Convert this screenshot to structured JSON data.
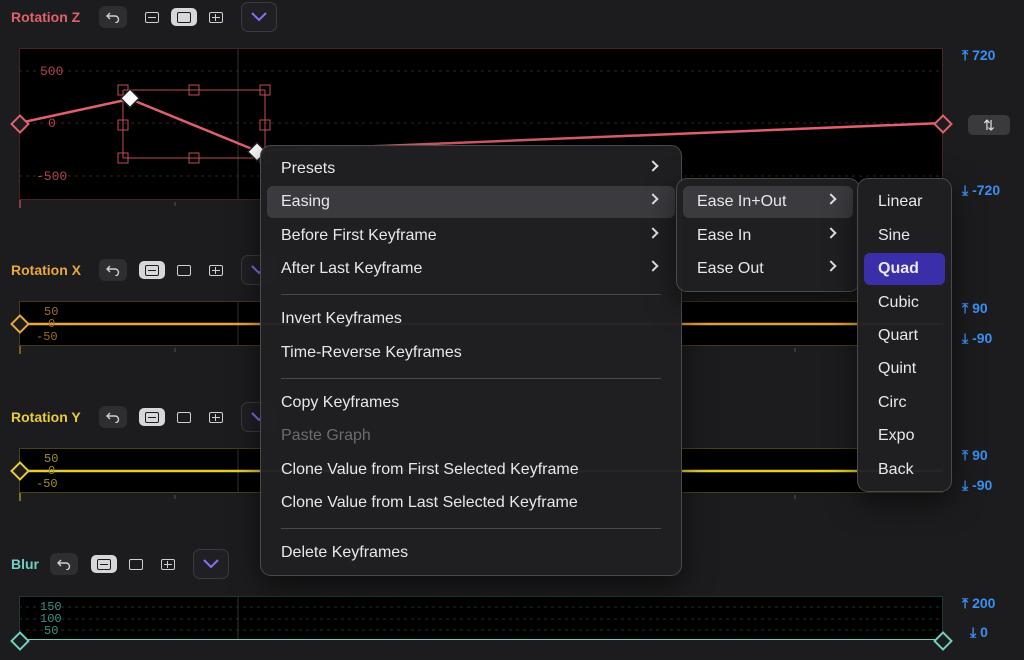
{
  "tracks": [
    {
      "name": "Rotation Z",
      "color": "#e0606e",
      "max_label": "720",
      "min_label": "-720",
      "y_ticks": [
        "500",
        "0",
        "-500"
      ]
    },
    {
      "name": "Rotation X",
      "color": "#e8a83e",
      "max_label": "90",
      "min_label": "-90",
      "y_ticks": [
        "50",
        "0",
        "-50"
      ]
    },
    {
      "name": "Rotation Y",
      "color": "#e6cc3c",
      "max_label": "90",
      "min_label": "-90",
      "y_ticks": [
        "50",
        "0",
        "-50"
      ]
    },
    {
      "name": "Blur",
      "color": "#6fd0c0",
      "max_label": "200",
      "min_label": "0",
      "y_ticks": [
        "150",
        "100",
        "50"
      ]
    }
  ],
  "context_menu": {
    "items": [
      {
        "label": "Presets",
        "submenu": true
      },
      {
        "label": "Easing",
        "submenu": true,
        "highlighted": true
      },
      {
        "label": "Before First Keyframe",
        "submenu": true
      },
      {
        "label": "After Last Keyframe",
        "submenu": true
      },
      {
        "label": "Invert Keyframes"
      },
      {
        "label": "Time-Reverse Keyframes"
      },
      {
        "label": "Copy Keyframes"
      },
      {
        "label": "Paste Graph",
        "disabled": true
      },
      {
        "label": "Clone Value from First Selected Keyframe"
      },
      {
        "label": "Clone Value from Last Selected Keyframe"
      },
      {
        "label": "Delete Keyframes"
      }
    ]
  },
  "easing_menu": {
    "items": [
      {
        "label": "Ease In+Out",
        "highlighted": true
      },
      {
        "label": "Ease In"
      },
      {
        "label": "Ease Out"
      }
    ]
  },
  "curve_menu": {
    "items": [
      "Linear",
      "Sine",
      "Quad",
      "Cubic",
      "Quart",
      "Quint",
      "Circ",
      "Expo",
      "Back"
    ],
    "selected": "Quad",
    "selected_color": "#3a2fa8"
  },
  "colors": {
    "accent_blue": "#3b8ff0",
    "background": "#1c1c1e"
  }
}
